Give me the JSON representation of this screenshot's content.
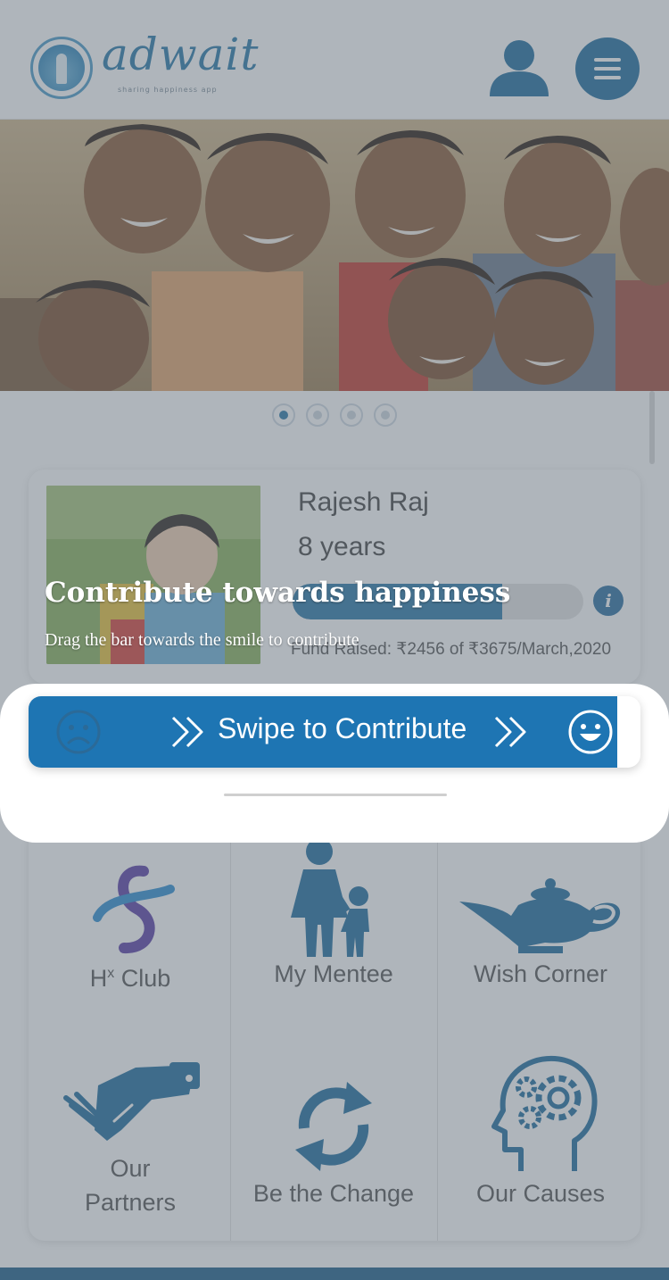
{
  "brand": {
    "name": "adwait",
    "tagline": "sharing happiness app"
  },
  "hero": {
    "slide_count": 4,
    "active_slide": 0
  },
  "mentee": {
    "name": "Rajesh Raj",
    "age": "8 years",
    "progress_fraction": 0.72,
    "fund_text": "Fund Raised: ₹2456 of ₹3675/March,2020",
    "info_icon_glyph": "i"
  },
  "tip": {
    "title": "Contribute towards happiness",
    "subtitle": "Drag the bar towards the smile to contribute"
  },
  "swipe": {
    "label": "Swipe to Contribute",
    "left_icon": "sad-face-icon",
    "right_icon": "smile-face-icon"
  },
  "features": [
    {
      "label_main": "H",
      "label_sup": "x",
      "label_rest": " Club",
      "icon": "hx-club-logo-icon"
    },
    {
      "label": "My Mentee",
      "icon": "mother-child-icon"
    },
    {
      "label": "Wish Corner",
      "icon": "magic-lamp-icon"
    },
    {
      "label_line1": "Our",
      "label_line2": "Partners",
      "icon": "handshake-icon"
    },
    {
      "label": "Be the Change",
      "icon": "refresh-cycle-icon"
    },
    {
      "label": "Our Causes",
      "icon": "head-gears-icon"
    }
  ],
  "colors": {
    "primary": "#1e75b3",
    "dark_blue": "#1f6d9e",
    "overlay": "rgba(96,108,120,0.50)"
  }
}
